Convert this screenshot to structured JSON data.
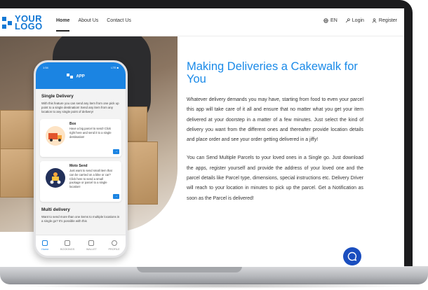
{
  "header": {
    "logo_line1": "YOUR",
    "logo_line2": "LOGO",
    "nav": [
      "Home",
      "About Us",
      "Contact Us"
    ],
    "language": "EN",
    "login": "Login",
    "register": "Register"
  },
  "phone": {
    "status_time": "1:54",
    "status_right": "LTE ■",
    "app_logo": "APP",
    "section1_title": "Single Delivery",
    "section1_text": "With this feature you can send any item from one pick up point to a single destination! Send any item from any location to any single point of delivery!",
    "cards": [
      {
        "title": "Box",
        "text": "Have a big parcel to send! Click right here and send it to a single destination!"
      },
      {
        "title": "Moto Send",
        "text": "Just want to send small item that can be carried on a bike or car? Click here to send a small package or parcel to a single location!"
      }
    ],
    "section2_title": "Multi delivery",
    "section2_text": "Want to send more than one items to multiple locations in a single go? It's possible with this",
    "tabs": [
      "Home",
      "BOOKINGS",
      "WALLET",
      "PROFILE"
    ]
  },
  "main": {
    "headline": "Making Deliveries a Cakewalk for You",
    "paragraph1": "Whatever delivery demands you may have, starting from food to even your parcel this app will take care of it all and ensure that no matter what you get your item delivered at your doorstep in a matter of a few minutes. Just select the kind of delivery you want from the different ones and thereafter provide location details and place order and see your order getting delivered in a jiffy!",
    "paragraph2": "You can Send Multiple Parcels to your loved ones in a Single go. Just download the apps, register yourself and provide the address of your loved one and the parcel details like Parcel type, dimensions, special instructions etc. Delivery Driver will reach to your location in minutes to pick up the parcel. Get a Notification as soon as the Parcel is delivered!"
  },
  "colors": {
    "accent": "#1a8ae8",
    "chat": "#1a4ebf"
  }
}
